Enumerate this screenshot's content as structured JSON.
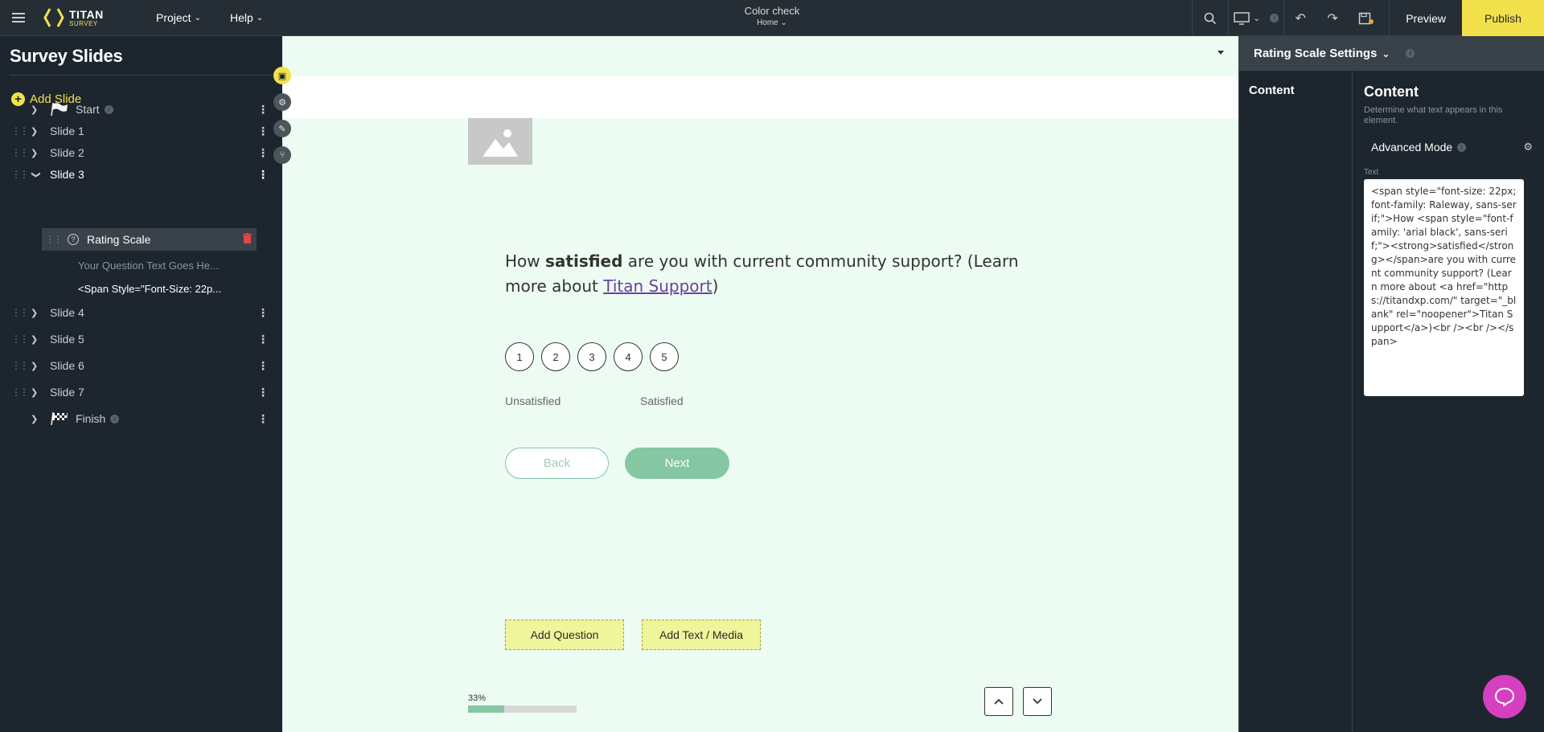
{
  "topbar": {
    "logo_title": "TITAN",
    "logo_sub": "SURVEY",
    "menu": [
      {
        "label": "Project"
      },
      {
        "label": "Help"
      }
    ],
    "project_name": "Color check",
    "page_name": "Home",
    "preview_label": "Preview",
    "publish_label": "Publish"
  },
  "sidebar": {
    "title": "Survey Slides",
    "add_slide_label": "Add Slide",
    "slides": [
      {
        "label": "Start"
      },
      {
        "label": "Slide 1"
      },
      {
        "label": "Slide 2"
      },
      {
        "label": "Slide 3"
      },
      {
        "label": "Slide 4"
      },
      {
        "label": "Slide 5"
      },
      {
        "label": "Slide 6"
      },
      {
        "label": "Slide 7"
      },
      {
        "label": "Finish"
      }
    ],
    "child": {
      "label": "Rating Scale",
      "sub_items": [
        "Your Question Text Goes He...",
        "<Span Style=\"Font-Size: 22p..."
      ]
    }
  },
  "canvas": {
    "question_pre": "How ",
    "question_bold": "satisfied",
    "question_mid": " are you with current community support? (Learn more about ",
    "question_link": "Titan Support",
    "question_post": ")",
    "ratings": [
      "1",
      "2",
      "3",
      "4",
      "5"
    ],
    "label_low": "Unsatisfied",
    "label_high": "Satisfied",
    "back_label": "Back",
    "next_label": "Next",
    "add_question_label": "Add Question",
    "add_text_media_label": "Add Text / Media",
    "progress_label": "33%",
    "progress_value": 0.33
  },
  "rpanel": {
    "header": "Rating Scale Settings",
    "tab": "Content",
    "heading": "Content",
    "description": "Determine what text appears in this element.",
    "advanced_mode_label": "Advanced Mode",
    "text_label": "Text",
    "text_value": "<span style=\"font-size: 22px; font-family: Raleway, sans-serif;\">How <span style=\"font-family: 'arial black', sans-serif;\"><strong>satisfied</strong></span>are you with current community support? (Learn more about <a href=\"https://titandxp.com/\" target=\"_blank\" rel=\"noopener\">Titan Support</a>)<br /><br /></span>"
  },
  "colors": {
    "accent": "#f2e14b",
    "canvas_bg": "#edfcf3",
    "button_green": "#85c6a3",
    "chat": "#d63fbf"
  }
}
